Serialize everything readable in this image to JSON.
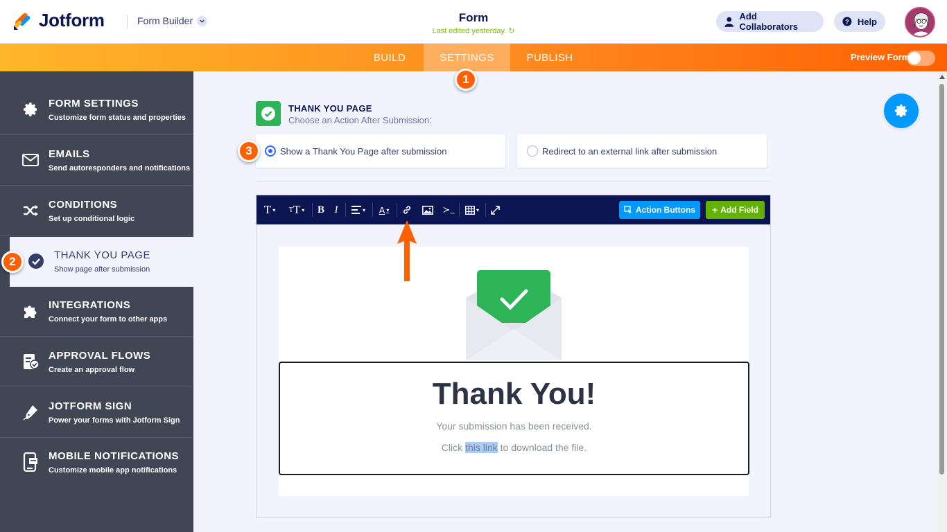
{
  "header": {
    "brand": "Jotform",
    "builder_label": "Form Builder",
    "form_title": "Form",
    "last_edited": "Last edited yesterday.",
    "add_collaborators": "Add Collaborators",
    "help": "Help"
  },
  "nav": {
    "tabs": [
      {
        "label": "BUILD"
      },
      {
        "label": "SETTINGS"
      },
      {
        "label": "PUBLISH"
      }
    ],
    "active_tab": "SETTINGS",
    "preview_form": "Preview Form"
  },
  "steps": [
    "1",
    "2",
    "3"
  ],
  "sidebar": {
    "items": [
      {
        "title": "FORM SETTINGS",
        "subtitle": "Customize form status and properties",
        "icon": "gear-icon"
      },
      {
        "title": "EMAILS",
        "subtitle": "Send autoresponders and notifications",
        "icon": "envelope-icon"
      },
      {
        "title": "CONDITIONS",
        "subtitle": "Set up conditional logic",
        "icon": "shuffle-icon"
      },
      {
        "title": "THANK YOU PAGE",
        "subtitle": "Show page after submission",
        "icon": "check-circle-icon"
      },
      {
        "title": "INTEGRATIONS",
        "subtitle": "Connect your form to other apps",
        "icon": "puzzle-icon"
      },
      {
        "title": "APPROVAL FLOWS",
        "subtitle": "Create an approval flow",
        "icon": "approval-icon"
      },
      {
        "title": "JOTFORM SIGN",
        "subtitle": "Power your forms with Jotform Sign",
        "icon": "pen-icon"
      },
      {
        "title": "MOBILE NOTIFICATIONS",
        "subtitle": "Customize mobile app notifications",
        "icon": "mobile-icon"
      }
    ],
    "active_item": "THANK YOU PAGE"
  },
  "thank_you": {
    "title": "THANK YOU PAGE",
    "subtitle": "Choose an Action After Submission:",
    "options": [
      {
        "label": "Show a Thank You Page after submission",
        "selected": true
      },
      {
        "label": "Redirect to an external link after submission",
        "selected": false
      }
    ]
  },
  "editor": {
    "action_buttons": "Action Buttons",
    "add_field": "Add Field",
    "heading": "Thank You!",
    "received": "Your submission has been received.",
    "click_prefix": "Click ",
    "link_text": "this link",
    "click_suffix": " to download the file."
  },
  "colors": {
    "brand_orange": "#ff6100",
    "accent_blue": "#0099ff",
    "success_green": "#2cb457",
    "add_field_green": "#64b200",
    "sidebar_bg": "#414655",
    "toolbar_bg": "#0a1551"
  }
}
